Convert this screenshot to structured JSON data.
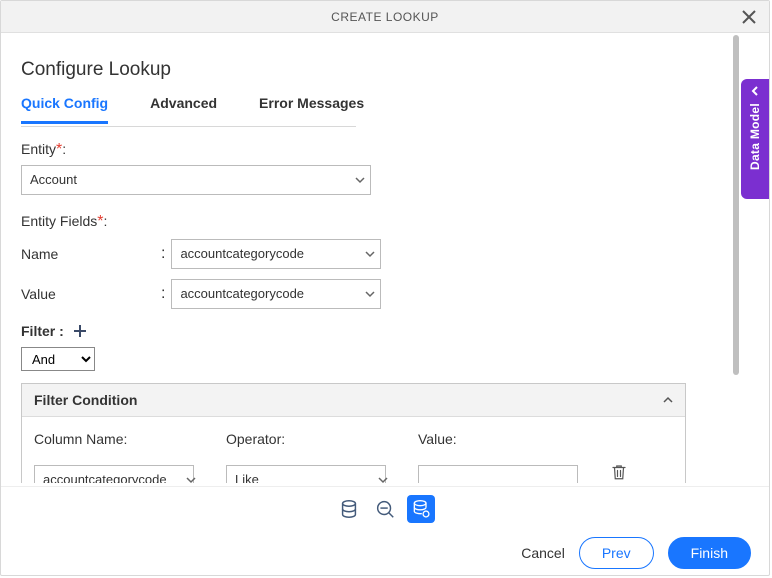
{
  "dialog": {
    "title": "CREATE LOOKUP"
  },
  "heading": "Configure Lookup",
  "tabs": {
    "quick": "Quick Config",
    "advanced": "Advanced",
    "errors": "Error Messages"
  },
  "entity": {
    "label": "Entity",
    "colon": ":",
    "value": "Account"
  },
  "entity_fields": {
    "label": "Entity Fields",
    "name_label": "Name",
    "name_value": "accountcategorycode",
    "value_label": "Value",
    "value_value": "accountcategorycode"
  },
  "filter": {
    "label": "Filter :",
    "logic": "And"
  },
  "condition": {
    "title": "Filter Condition",
    "column_label": "Column Name:",
    "column_value": "accountcategorycode",
    "operator_label": "Operator:",
    "operator_value": "Like",
    "value_label": "Value:",
    "value_value": ""
  },
  "footer": {
    "cancel": "Cancel",
    "prev": "Prev",
    "finish": "Finish"
  },
  "side_tab": "Data Model"
}
